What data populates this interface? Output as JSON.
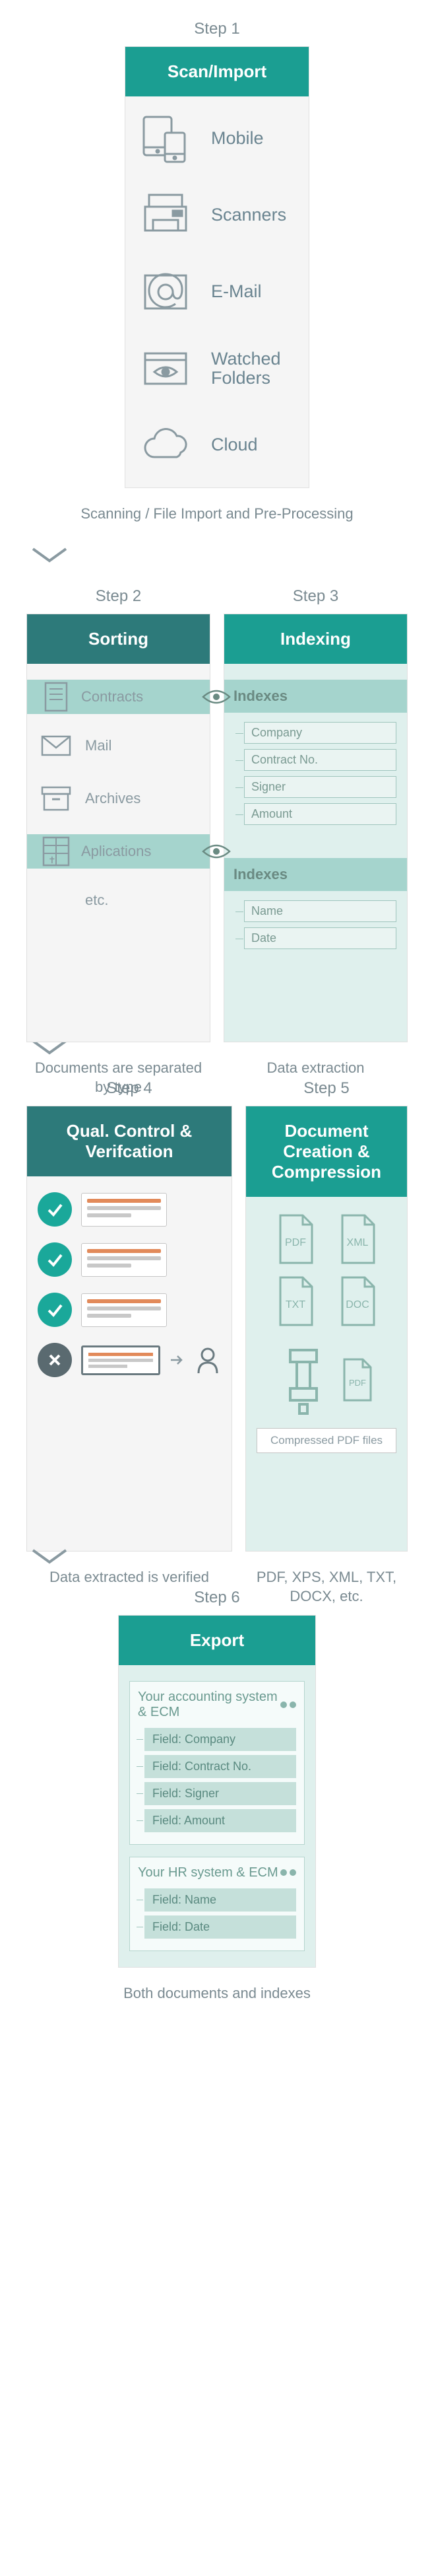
{
  "colors": {
    "tealHeader": "#1b9e92",
    "darkHeader": "#2d7a7a",
    "band": "#a5d4cd",
    "text": "#6a8490",
    "stroke": "#8a9aa1"
  },
  "step1": {
    "step": "Step 1",
    "title": "Scan/Import",
    "items": [
      {
        "icon": "mobile-icon",
        "label": "Mobile"
      },
      {
        "icon": "scanner-icon",
        "label": "Scanners"
      },
      {
        "icon": "email-icon",
        "label": "E-Mail"
      },
      {
        "icon": "watched-folders-icon",
        "label": "Watched Folders"
      },
      {
        "icon": "cloud-icon",
        "label": "Cloud"
      }
    ],
    "caption": "Scanning / File Import and Pre-Processing"
  },
  "step2": {
    "step": "Step 2",
    "title": "Sorting",
    "items": [
      {
        "label": "Contracts",
        "band": true
      },
      {
        "label": "Mail",
        "band": false
      },
      {
        "label": "Archives",
        "band": false
      },
      {
        "label": "Aplications",
        "band": true
      },
      {
        "label": "etc.",
        "band": false
      }
    ],
    "caption": "Documents are separated by type"
  },
  "step3": {
    "step": "Step 3",
    "title": "Indexing",
    "groups": [
      {
        "title": "Indexes",
        "fields": [
          "Company",
          "Contract No.",
          "Signer",
          "Amount"
        ]
      },
      {
        "title": "Indexes",
        "fields": [
          "Name",
          "Date"
        ]
      }
    ],
    "caption": "Data extraction"
  },
  "step4": {
    "step": "Step 4",
    "title": "Qual. Control & Verifcation",
    "caption": "Data extracted is verified"
  },
  "step5": {
    "step": "Step 5",
    "title": "Document Creation & Compression",
    "files": [
      "PDF",
      "XML",
      "TXT",
      "DOC"
    ],
    "compressed": "Compressed PDF files",
    "caption": "PDF, XPS, XML, TXT, DOCX, etc."
  },
  "step6": {
    "step": "Step 6",
    "title": "Export",
    "systems": [
      {
        "name": "Your accounting system & ECM",
        "fields": [
          "Field: Company",
          "Field: Contract No.",
          "Field: Signer",
          "Field: Amount"
        ]
      },
      {
        "name": "Your HR system & ECM",
        "fields": [
          "Field: Name",
          "Field: Date"
        ]
      }
    ],
    "caption": "Both documents and indexes"
  }
}
